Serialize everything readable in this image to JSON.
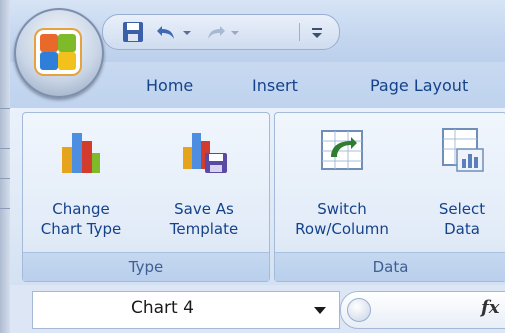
{
  "quick_access": {
    "save_icon": "save-icon",
    "undo_icon": "undo-icon",
    "redo_icon": "redo-icon",
    "customize_icon": "customize-qat-icon"
  },
  "tabs": [
    {
      "label": "Home"
    },
    {
      "label": "Insert"
    },
    {
      "label": "Page Layout"
    }
  ],
  "ribbon": {
    "groups": [
      {
        "caption": "Type",
        "buttons": [
          {
            "label": "Change\nChart Type",
            "icon": "change-chart-type-icon"
          },
          {
            "label": "Save As\nTemplate",
            "icon": "save-as-template-icon"
          }
        ]
      },
      {
        "caption": "Data",
        "buttons": [
          {
            "label": "Switch\nRow/Column",
            "icon": "switch-row-column-icon"
          },
          {
            "label": "Select\nData",
            "icon": "select-data-icon"
          }
        ]
      }
    ]
  },
  "name_box": {
    "value": "Chart 4"
  },
  "formula_bar": {
    "fx_label": "fx"
  },
  "colors": {
    "tab_text": "#15428b",
    "ribbon_bg": "#dfe9f6",
    "office_orange": "#e6a23c"
  }
}
